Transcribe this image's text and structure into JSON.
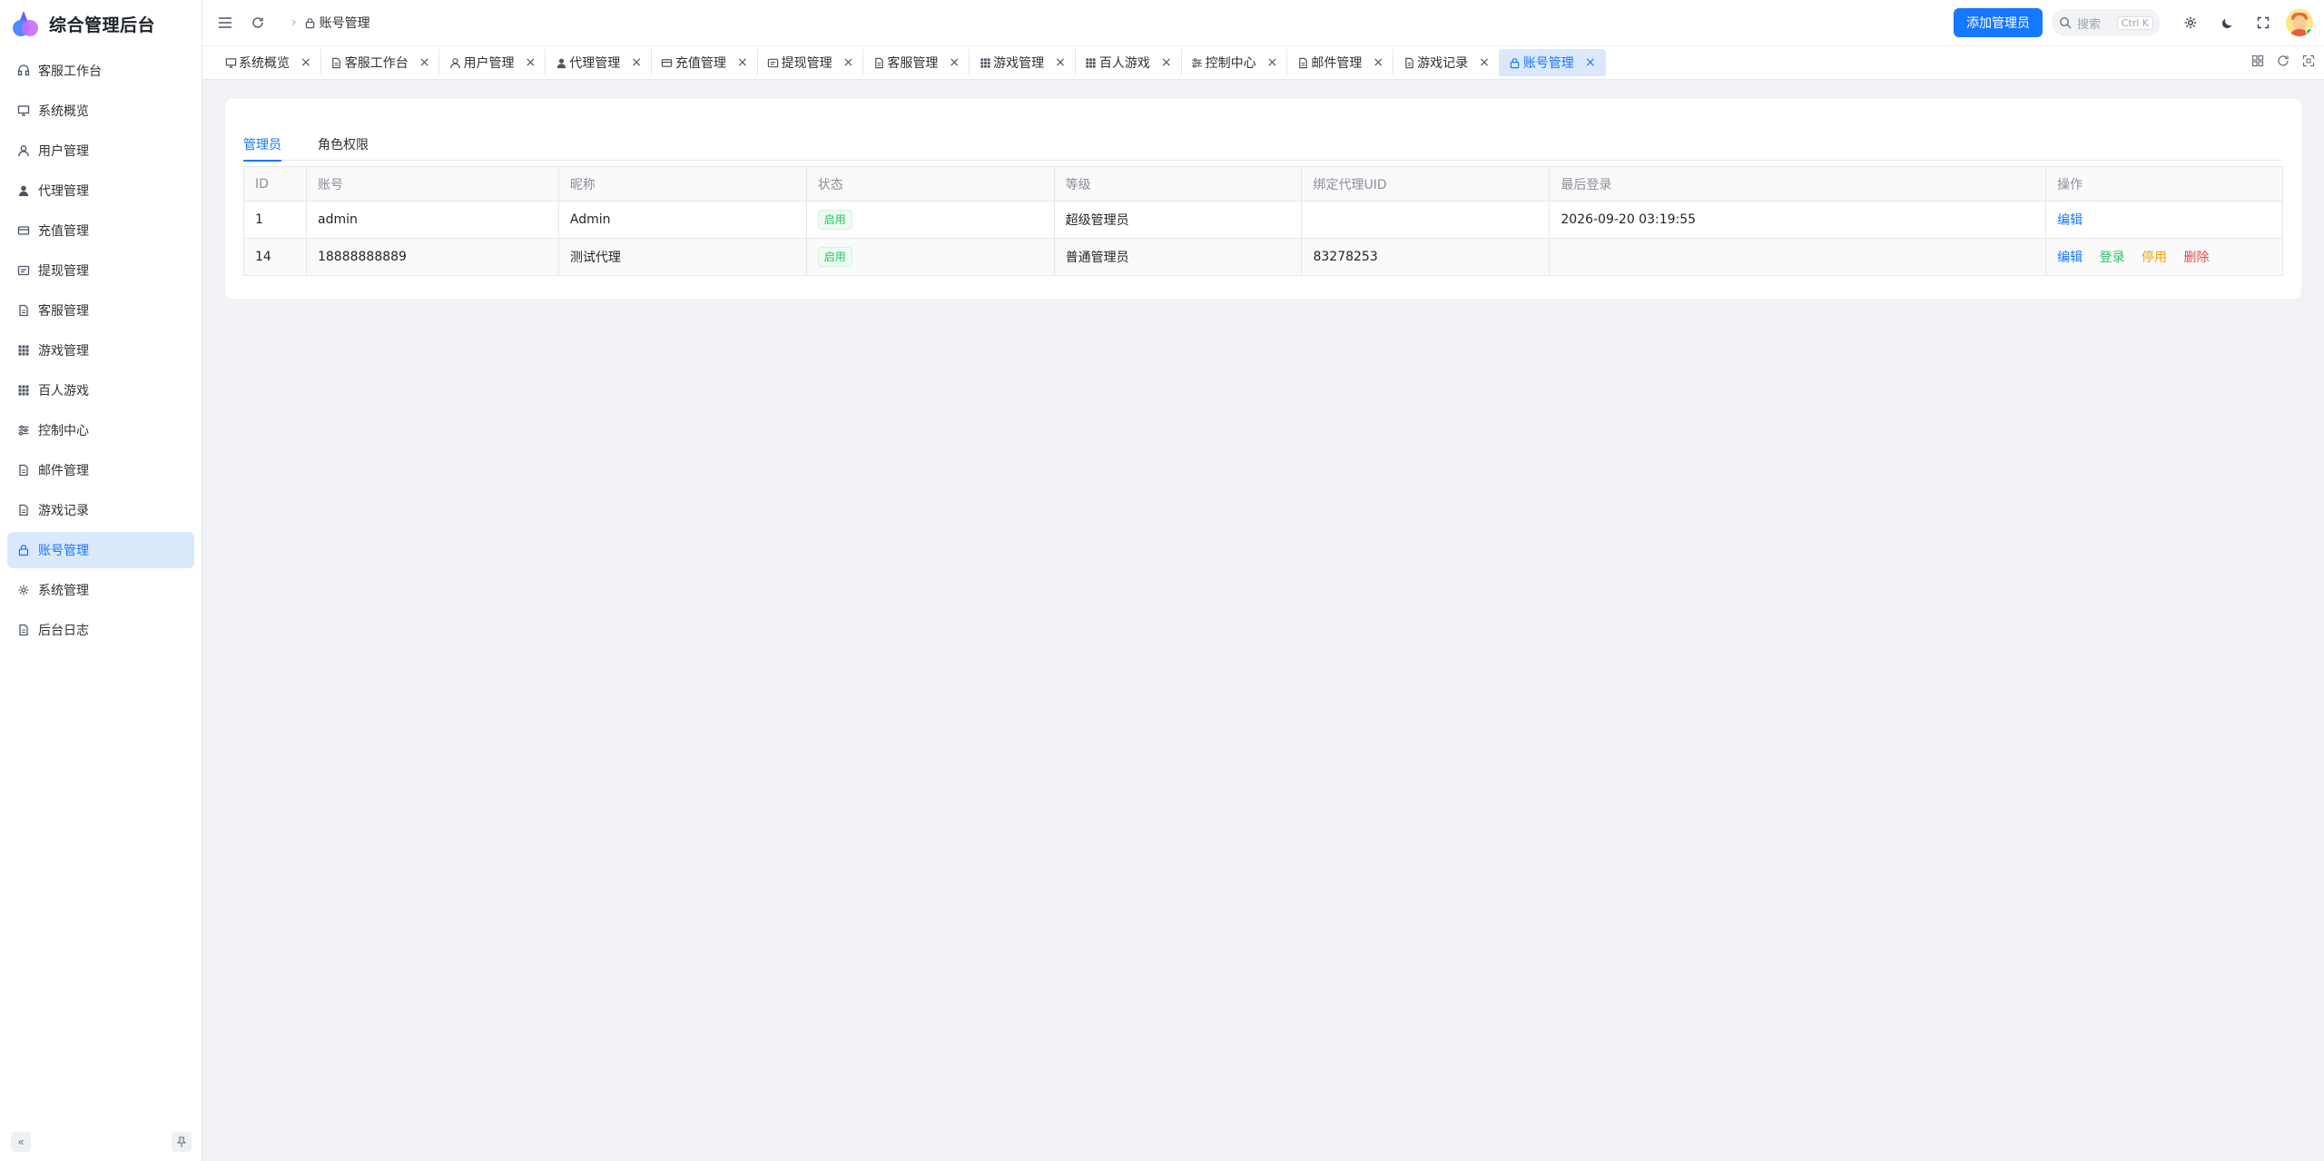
{
  "app": {
    "title": "综合管理后台"
  },
  "sidebar": {
    "items": [
      {
        "label": "客服工作台",
        "icon": "headset-icon"
      },
      {
        "label": "系统概览",
        "icon": "monitor-icon"
      },
      {
        "label": "用户管理",
        "icon": "user-icon"
      },
      {
        "label": "代理管理",
        "icon": "user-solid-icon"
      },
      {
        "label": "充值管理",
        "icon": "card-icon"
      },
      {
        "label": "提现管理",
        "icon": "wallet-icon"
      },
      {
        "label": "客服管理",
        "icon": "doc-icon"
      },
      {
        "label": "游戏管理",
        "icon": "grid-icon"
      },
      {
        "label": "百人游戏",
        "icon": "grid-icon"
      },
      {
        "label": "控制中心",
        "icon": "sliders-icon"
      },
      {
        "label": "邮件管理",
        "icon": "doc-icon"
      },
      {
        "label": "游戏记录",
        "icon": "doc-icon"
      },
      {
        "label": "账号管理",
        "icon": "lock-icon",
        "active": true
      },
      {
        "label": "系统管理",
        "icon": "gear-icon"
      },
      {
        "label": "后台日志",
        "icon": "doc-icon"
      }
    ]
  },
  "header": {
    "breadcrumb": "账号管理",
    "add_admin_label": "添加管理员",
    "search_placeholder": "搜索",
    "search_shortcut": "Ctrl K"
  },
  "tabs": [
    {
      "label": "系统概览",
      "icon": "monitor-icon"
    },
    {
      "label": "客服工作台",
      "icon": "doc-icon"
    },
    {
      "label": "用户管理",
      "icon": "user-icon"
    },
    {
      "label": "代理管理",
      "icon": "user-solid-icon"
    },
    {
      "label": "充值管理",
      "icon": "card-icon"
    },
    {
      "label": "提现管理",
      "icon": "wallet-icon"
    },
    {
      "label": "客服管理",
      "icon": "doc-icon"
    },
    {
      "label": "游戏管理",
      "icon": "grid-icon"
    },
    {
      "label": "百人游戏",
      "icon": "grid-icon"
    },
    {
      "label": "控制中心",
      "icon": "sliders-icon"
    },
    {
      "label": "邮件管理",
      "icon": "doc-icon"
    },
    {
      "label": "游戏记录",
      "icon": "doc-icon"
    },
    {
      "label": "账号管理",
      "icon": "lock-icon",
      "active": true
    }
  ],
  "content": {
    "subtabs": [
      "管理员",
      "角色权限"
    ],
    "table": {
      "headers": [
        "ID",
        "账号",
        "昵称",
        "状态",
        "等级",
        "绑定代理UID",
        "最后登录",
        "操作"
      ],
      "rows": [
        {
          "id": "1",
          "account": "admin",
          "nickname": "Admin",
          "status": "启用",
          "level": "超级管理员",
          "agent_uid": "",
          "last_login": "2026-09-20 03:19:55",
          "ops": [
            "编辑"
          ]
        },
        {
          "id": "14",
          "account": "18888888889",
          "nickname": "测试代理",
          "status": "启用",
          "level": "普通管理员",
          "agent_uid": "83278253",
          "last_login": "",
          "ops": [
            "编辑",
            "登录",
            "停用",
            "删除"
          ]
        }
      ]
    }
  },
  "colors": {
    "primary": "#1677ff",
    "success": "#22c55e",
    "warning": "#f59e0b",
    "danger": "#ef4444",
    "active_bg": "#dbe8fb"
  }
}
